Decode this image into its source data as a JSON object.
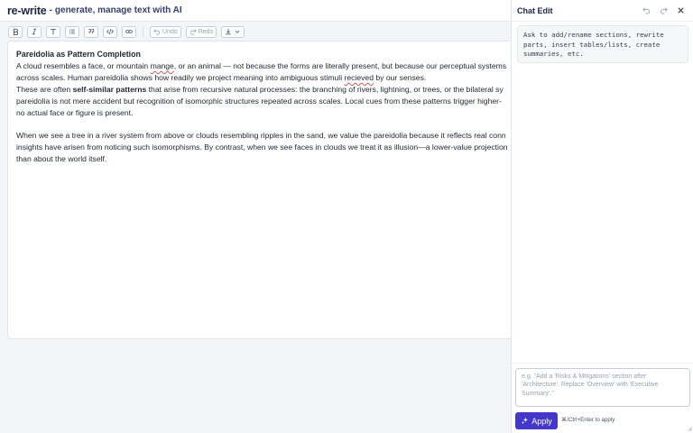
{
  "app": {
    "name": "re-write",
    "tagline_dash": "-",
    "tagline": "generate, manage text with AI"
  },
  "toolbar": {
    "bold_icon": "bold-icon",
    "italic_icon": "italic-icon",
    "heading_icon": "heading-icon",
    "list_icon": "bullet-list-icon",
    "quote_icon": "quote-icon",
    "code_icon": "code-icon",
    "link_icon": "link-icon",
    "undo_label": "Undo",
    "redo_label": "Redo",
    "export_icon": "download-icon"
  },
  "document": {
    "heading": "Pareidolia as Pattern Completion",
    "p1": [
      {
        "pre": "A cloud resembles a face, or mountain ",
        "typo": "mange",
        "post": ", or an animal — not because the forms are literally present, but because our perceptual systems"
      },
      {
        "pre": "across scales. Human pareidolia shows how readily we project meaning into ambiguous stimuli ",
        "typo": "recieved",
        "post": " by our senses."
      }
    ],
    "p2": {
      "line1_pre": "These are often ",
      "line1_bold": "self-similar patterns",
      "line1_post": " that arise from recursive natural processes: the branching of rivers, lightning, or trees, or the bilateral sy",
      "line2": "pareidolia is not mere accident but recognition of isomorphic structures repeated across scales. Local cues from these patterns trigger higher-",
      "line3": "no actual face or figure is present."
    },
    "p3": [
      "When we see a tree in a river system from above or clouds resembling ripples in the sand, we value the pareidolia because it reflects real conn",
      "insights have arisen from noticing such isomorphisms. By contrast, when we see faces in clouds we treat it as illusion—a lower-value projection",
      "than about the world itself."
    ]
  },
  "chat": {
    "title": "Chat Edit",
    "undo_icon": "undo-icon",
    "redo_icon": "redo-icon",
    "close_icon": "close-icon",
    "hint": "Ask to add/rename sections, rewrite\nparts, insert tables/lists, create\nsummaries, etc.",
    "input_value": "",
    "input_placeholder": "e.g. \"Add a 'Risks & Mitigations' section after 'Architecture'. Replace 'Overview' with 'Executive Summary'.\"",
    "apply_label": "Apply",
    "shortcut": "⌘/Ctrl+Enter to apply"
  },
  "colors": {
    "accent": "#4338ca",
    "brand_text": "#1d2440",
    "background": "#f4f5f8"
  }
}
